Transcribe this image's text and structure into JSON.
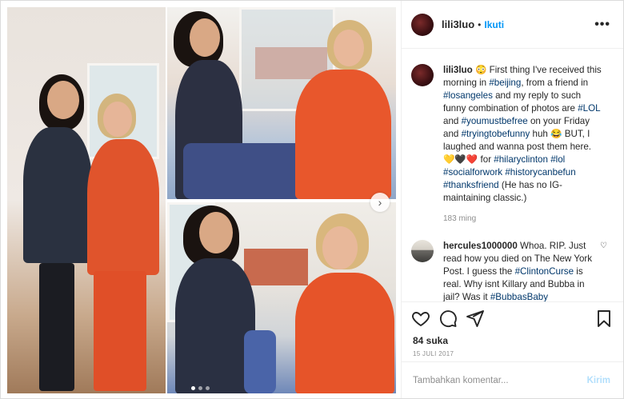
{
  "post": {
    "username": "lili3luo",
    "follow_label": "Ikuti",
    "separator": "•",
    "more_label": "•••"
  },
  "caption": {
    "username": "lili3luo",
    "emoji_start": "😳",
    "parts": [
      {
        "text": " First thing I've received this morning in ",
        "tag": false
      },
      {
        "text": "#beijing",
        "tag": true
      },
      {
        "text": ", from a friend in ",
        "tag": false
      },
      {
        "text": "#losangeles",
        "tag": true
      },
      {
        "text": " and my reply to such funny combination of photos are ",
        "tag": false
      },
      {
        "text": "#LOL",
        "tag": true
      },
      {
        "text": " and ",
        "tag": false
      },
      {
        "text": "#youmustbefree",
        "tag": true
      },
      {
        "text": " on your Friday and ",
        "tag": false
      },
      {
        "text": "#tryingtobefunny",
        "tag": true
      },
      {
        "text": " huh 😂 BUT, I laughed and wanna post them here. 💛🖤❤️ for ",
        "tag": false
      },
      {
        "text": "#hilaryclinton",
        "tag": true
      },
      {
        "text": " ",
        "tag": false
      },
      {
        "text": "#lol",
        "tag": true
      },
      {
        "text": " ",
        "tag": false
      },
      {
        "text": "#socialforwork",
        "tag": true
      },
      {
        "text": " ",
        "tag": false
      },
      {
        "text": "#historycanbefun",
        "tag": true
      },
      {
        "text": " ",
        "tag": false
      },
      {
        "text": "#thanksfriend",
        "tag": true
      },
      {
        "text": " (He has no IG-maintaining classic.)",
        "tag": false
      }
    ],
    "time": "183 ming"
  },
  "reply": {
    "username": "hercules1000000",
    "parts": [
      {
        "text": " Whoa. RIP. Just read how you died on The New York Post. I guess the ",
        "tag": false
      },
      {
        "text": "#ClintonCurse",
        "tag": true
      },
      {
        "text": " is real. Why isnt Killary and Bubba in jail? Was it ",
        "tag": false
      },
      {
        "text": "#BubbasBaby",
        "tag": true
      }
    ]
  },
  "actions": {
    "icons": [
      "heart-icon",
      "comment-icon",
      "share-icon",
      "bookmark-icon"
    ],
    "likes": "84 suka",
    "date": "15 JULI 2017"
  },
  "comment_box": {
    "placeholder": "Tambahkan komentar...",
    "post_label": "Kirim"
  },
  "media": {
    "carousel_next": "›",
    "dots": 3,
    "active_dot": 0
  }
}
